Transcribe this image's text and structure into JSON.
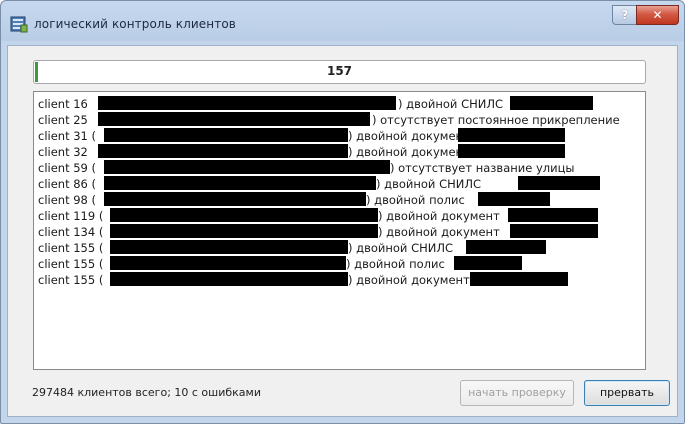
{
  "window": {
    "title": "логический контроль клиентов",
    "help_label": "?",
    "close_label": "✕"
  },
  "progress": {
    "value_text": "157"
  },
  "log": {
    "lines": [
      {
        "client": "client 16",
        "message": ") двойной СНИЛС"
      },
      {
        "client": "client 25",
        "message": ") отсутствует постоянное прикрепление"
      },
      {
        "client": "client 31 (",
        "message": ") двойной документ"
      },
      {
        "client": "client 32",
        "message": ") двойной документ"
      },
      {
        "client": "client 59 (",
        "message": ") отсутствует название улицы"
      },
      {
        "client": "client 86 (",
        "message": ") двойной СНИЛС"
      },
      {
        "client": "client 98 (",
        "message": ") двойной полис"
      },
      {
        "client": "client 119 (",
        "message": ") двойной документ"
      },
      {
        "client": "client 134 (",
        "message": ") двойной документ"
      },
      {
        "client": "client 155 (",
        "message": ") двойной СНИЛС"
      },
      {
        "client": "client 155 (",
        "message": ") двойной полис"
      },
      {
        "client": "client 155 (",
        "message": ") двойной документ"
      }
    ]
  },
  "status": {
    "summary": "297484 клиентов всего; 10 с ошибками"
  },
  "buttons": {
    "start_check": "начать проверку",
    "abort": "прервать"
  }
}
